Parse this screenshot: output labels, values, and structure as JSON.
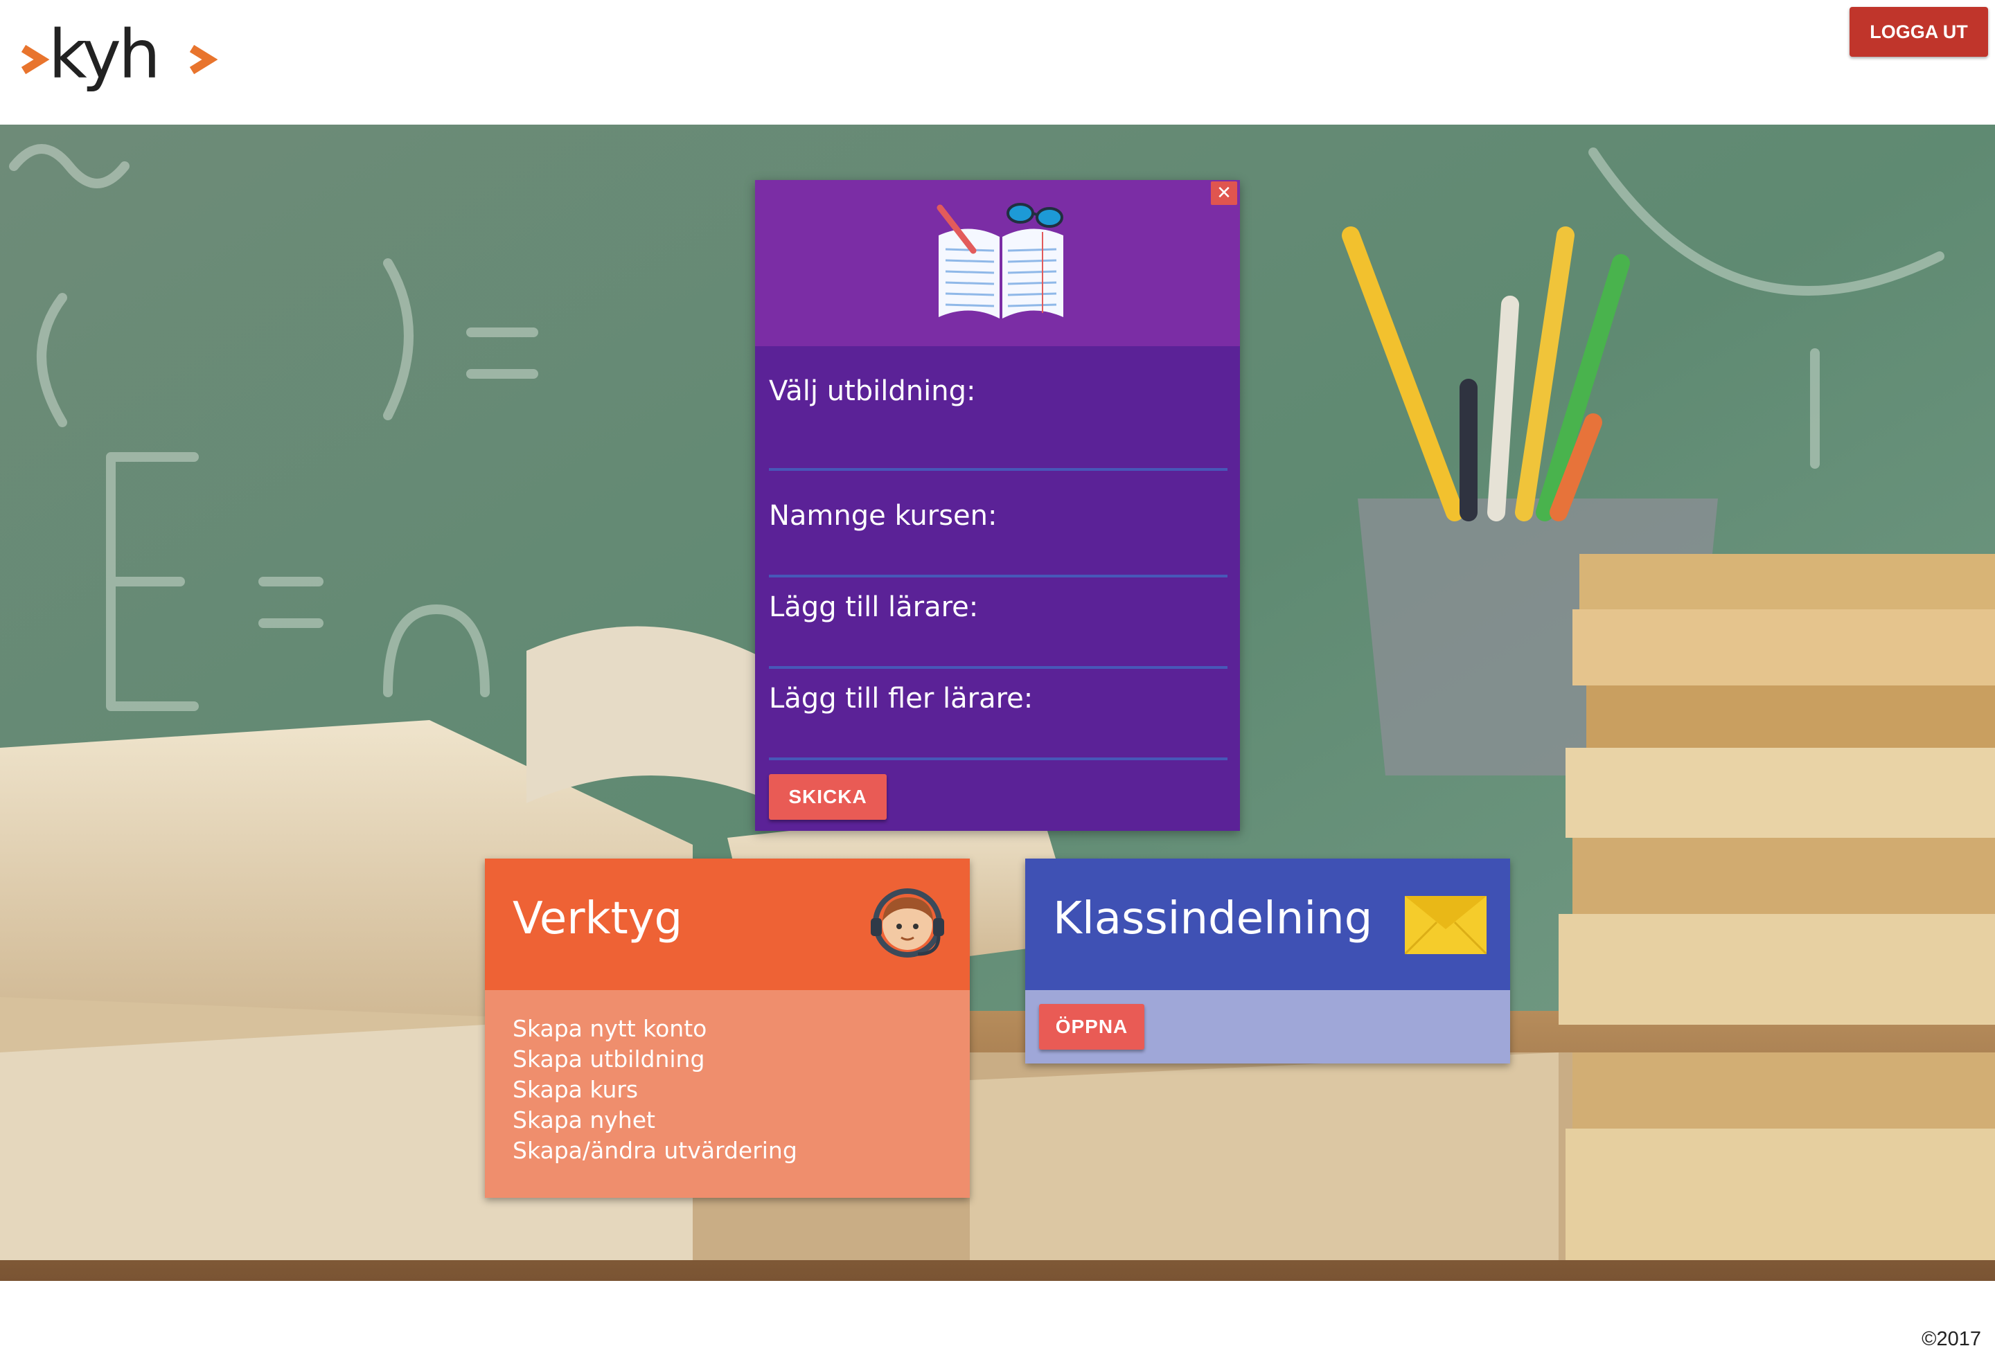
{
  "header": {
    "logo_text": "kyh",
    "logout_label": "LOGGA UT"
  },
  "modal": {
    "fields": [
      {
        "label": "Välj utbildning:"
      },
      {
        "label": "Namnge kursen:"
      },
      {
        "label": "Lägg till lärare:"
      },
      {
        "label": "Lägg till fler lärare:"
      }
    ],
    "submit_label": "SKICKA",
    "close_label": "✕"
  },
  "cards": {
    "tools": {
      "title": "Verktyg",
      "items": [
        "Skapa nytt konto",
        "Skapa utbildning",
        "Skapa kurs",
        "Skapa nyhet",
        "Skapa/ändra utvärdering"
      ]
    },
    "classes": {
      "title": "Klassindelning",
      "open_label": "ÖPPNA"
    }
  },
  "footer": {
    "copyright": "©2017"
  },
  "colors": {
    "accent_orange": "#ee6235",
    "modal_purple": "#5b2297",
    "modal_header_purple": "#7b2da5",
    "class_blue": "#3f51b4",
    "button_red": "#e95b55",
    "logout_red": "#c0352b"
  },
  "icons": {
    "logo": "kyh-logo",
    "modal": "open-book-icon",
    "tools": "headset-agent-icon",
    "classes": "envelope-icon",
    "close": "close-icon"
  }
}
